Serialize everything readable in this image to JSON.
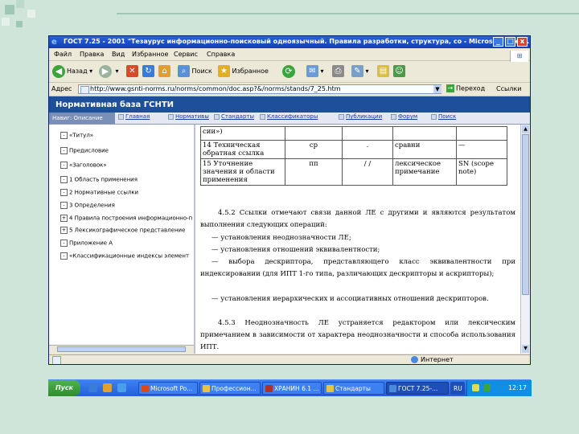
{
  "colors": {
    "background": "#cfe5da",
    "banner": "#1e4f9a",
    "title_bar": "#0f3fb4",
    "taskbar": "#245edb",
    "start": "#2e8b2e",
    "link": "#1a3aa0"
  },
  "window": {
    "title": "ГОСТ 7.25 - 2001 \"Тезаурус информационно-поисковый одноязычный. Правила разработки, структура, со - Microsoft Inter...",
    "min_label": "_",
    "max_label": "□",
    "close_label": "x"
  },
  "menu": [
    "Файл",
    "Правка",
    "Вид",
    "Избранное",
    "Сервис",
    "Справка"
  ],
  "toolbar": {
    "back_label": "Назад",
    "search_label": "Поиск",
    "favorites_label": "Избранное"
  },
  "address": {
    "label": "Адрес",
    "url": "http://www.gsnti-norms.ru/norms/common/doc.asp?&/norms/stands/7_25.htm",
    "go_label": "Переход",
    "links_label": "Ссылки"
  },
  "banner": "Нормативная база ГСНТИ",
  "nav": {
    "left_label": "Навиг: Описание",
    "links": [
      "Главная",
      "Нормативы",
      "Стандарты",
      "Классификаторы",
      "Публикации",
      "Форум",
      "Поиск"
    ]
  },
  "sidebar": {
    "items": [
      {
        "mark": "-",
        "label": "«Титул»"
      },
      {
        "mark": "-",
        "label": "Предисловие"
      },
      {
        "mark": "-",
        "label": "«Заголовок»"
      },
      {
        "mark": "-",
        "label": "1 Область применения"
      },
      {
        "mark": "-",
        "label": "2 Нормативные ссылки"
      },
      {
        "mark": "-",
        "label": "3 Определения"
      },
      {
        "mark": "+",
        "label": "4 Правила построения информационно-п"
      },
      {
        "mark": "+",
        "label": "5 Лексикографическое представление"
      },
      {
        "mark": "-",
        "label": "Приложение А"
      },
      {
        "mark": "-",
        "label": "«Классификационные индексы элемент"
      }
    ]
  },
  "table": {
    "rows": [
      [
        "сии»)",
        "",
        "",
        "",
        ""
      ],
      [
        "14 Техническая обратная ссылка",
        "ср",
        ".",
        "сравни",
        "—"
      ],
      [
        "15 Уточнение значения и области применения",
        "пп",
        "/ /",
        "лексическое примечание",
        "SN (scope note)"
      ]
    ]
  },
  "paragraphs": [
    "4.5.2 Ссылки отмечают связи данной ЛЕ с другими и являются результатом выполнения следующих операций:",
    "— установления неоднозначности ЛЕ;",
    "— установления отношений эквивалентности;",
    "— выбора дескриптора, представляющего класс эквивалентности при индексировании (для ИПТ 1-го типа, различающих дескрипторы и аскрипторы);",
    "— установления иерархических и ассоциативных отношений дескрипторов.",
    "4.5.3 Неоднозначность ЛЕ устраняется редактором или лексическим примечанием в зависимости от характера неоднозначности и способа использования ИПТ."
  ],
  "status": {
    "zone": "Интернет"
  },
  "taskbar": {
    "start_label": "Пуск",
    "tasks": [
      {
        "label": "Microsoft Po...",
        "color": "#d84a1b"
      },
      {
        "label": "Профессион...",
        "color": "#e8c04a"
      },
      {
        "label": "ХРАНИН 6.1 ...",
        "color": "#b0302a"
      },
      {
        "label": "Стандарты",
        "color": "#e8c04a"
      },
      {
        "label": "ГОСТ 7.25-...",
        "color": "#4a8ad8"
      },
      {
        "label": "RU",
        "color": "#4a8ad8"
      }
    ],
    "clock": "12:17"
  }
}
